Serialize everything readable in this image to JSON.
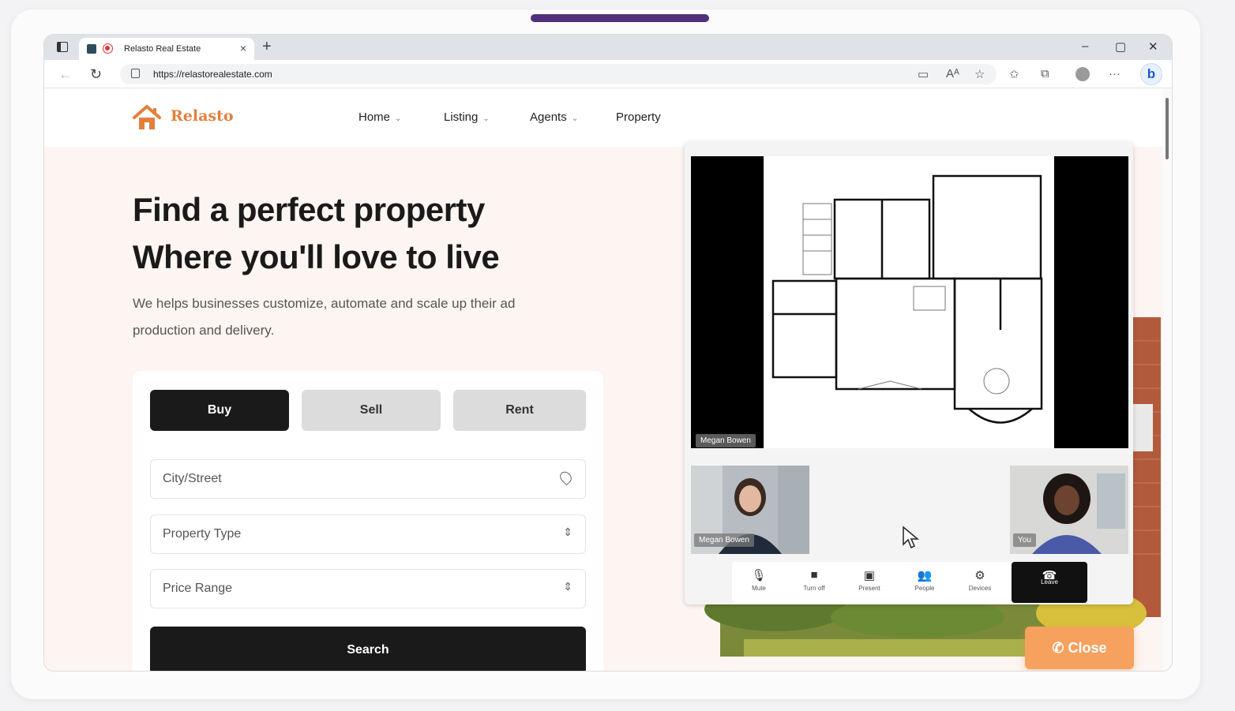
{
  "browser": {
    "tab_title": "Relasto Real Estate",
    "tab_close": "×",
    "new_tab": "+",
    "url": "https://relastorealestate.com",
    "window_controls": [
      "–",
      "▢",
      "✕"
    ],
    "toolbar_icons": [
      "camera-icon",
      "read-aloud-icon",
      "add-favorite-icon",
      "favorites-icon",
      "collections-icon",
      "profile-icon",
      "more-icon",
      "bing-icon"
    ],
    "more": "···",
    "bing": "b"
  },
  "site": {
    "logo_text": "Relasto",
    "brand_color": "#e2803c",
    "nav": [
      {
        "label": "Home",
        "dropdown": true
      },
      {
        "label": "Listing",
        "dropdown": true
      },
      {
        "label": "Agents",
        "dropdown": true
      },
      {
        "label": "Property",
        "dropdown": false
      }
    ],
    "hero": {
      "title_line1": "Find a perfect property",
      "title_line2": "Where you'll love to live",
      "subtitle": "We helps businesses customize, automate and scale up their ad production and delivery."
    },
    "search": {
      "tabs": [
        {
          "label": "Buy",
          "active": true
        },
        {
          "label": "Sell",
          "active": false
        },
        {
          "label": "Rent",
          "active": false
        }
      ],
      "city_placeholder": "City/Street",
      "property_type": "Property Type",
      "price_range": "Price Range",
      "search_label": "Search"
    }
  },
  "call": {
    "presenter_name": "Megan Bowen",
    "participants": [
      {
        "name": "Megan Bowen"
      },
      {
        "name": "You"
      }
    ],
    "controls": [
      {
        "label": "Mute",
        "icon": "mic-icon"
      },
      {
        "label": "Turn off",
        "icon": "video-icon"
      },
      {
        "label": "Present",
        "icon": "present-icon"
      },
      {
        "label": "People",
        "icon": "people-icon"
      },
      {
        "label": "Devices",
        "icon": "gear-icon"
      }
    ],
    "leave_label": "Leave",
    "close_label": "Close",
    "close_color": "#f7a15f"
  }
}
